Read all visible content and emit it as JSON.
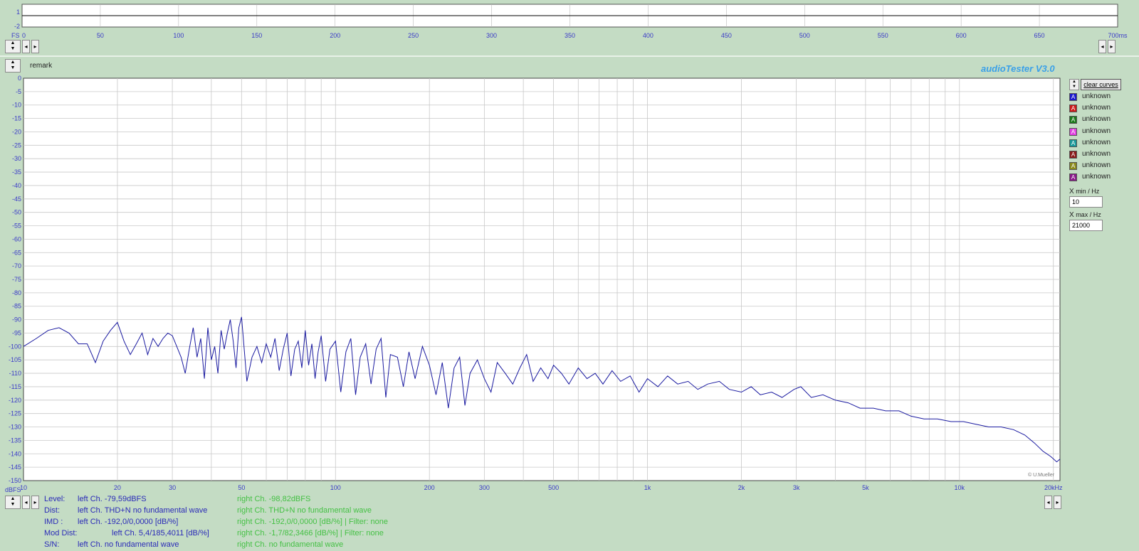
{
  "window": {
    "brand": "audioTester  V3.0",
    "remark_label": "remark",
    "copyright": "© U.Mueller"
  },
  "time_plot": {
    "ylabel": "FS",
    "yticks": [
      "1",
      "-2"
    ],
    "xticks": [
      "0",
      "50",
      "100",
      "150",
      "200",
      "250",
      "300",
      "350",
      "400",
      "450",
      "500",
      "550",
      "600",
      "650",
      "700ms"
    ]
  },
  "controls": {
    "clear_curves": "clear curves",
    "xmin_label": "min / Hz",
    "xmin_value": "10",
    "xmax_label": "max / Hz",
    "xmax_value": "21000"
  },
  "legend": [
    {
      "label": "unknown",
      "color": "#1a1acc"
    },
    {
      "label": "unknown",
      "color": "#cc1a1a"
    },
    {
      "label": "unknown",
      "color": "#1a7a1a"
    },
    {
      "label": "unknown",
      "color": "#e040e0"
    },
    {
      "label": "unknown",
      "color": "#1a9a9a"
    },
    {
      "label": "unknown",
      "color": "#8a1a1a"
    },
    {
      "label": "unknown",
      "color": "#8a8a1a"
    },
    {
      "label": "unknown",
      "color": "#8a1a8a"
    }
  ],
  "status": {
    "level": {
      "label": "Level:",
      "left": "left Ch. -79,59dBFS",
      "right": "right Ch. -98,82dBFS"
    },
    "dist": {
      "label": "Dist:",
      "left": "left Ch. THD+N  no fundamental wave",
      "right": "right Ch. THD+N  no fundamental wave"
    },
    "imd": {
      "label": "IMD  :",
      "left": "left Ch. -192,0/0,0000 [dB/%]",
      "right": "right Ch. -192,0/0,0000 [dB/%] |   Filter: none"
    },
    "moddist": {
      "label": "Mod Dist:",
      "left": "left Ch. 5,4/185,4011 [dB/%]",
      "right": "right Ch. -1,7/82,3466 [dB/%]  |   Filter: none"
    },
    "sn": {
      "label": "S/N:",
      "left": "left Ch.  no fundamental wave",
      "right": "right Ch.  no fundamental wave"
    }
  },
  "chart_data": {
    "type": "line",
    "title": "",
    "xlabel": "",
    "ylabel": "dBFS",
    "x_scale": "log",
    "xlim": [
      10,
      21000
    ],
    "ylim": [
      -150,
      0
    ],
    "grid": true,
    "xtick_labels": [
      "10",
      "20",
      "30",
      "50",
      "100",
      "200",
      "300",
      "500",
      "1k",
      "2k",
      "3k",
      "5k",
      "10k",
      "20kHz"
    ],
    "xtick_values": [
      10,
      20,
      30,
      50,
      100,
      200,
      300,
      500,
      1000,
      2000,
      3000,
      5000,
      10000,
      20000
    ],
    "ytick_values": [
      0,
      -5,
      -10,
      -15,
      -20,
      -25,
      -30,
      -35,
      -40,
      -45,
      -50,
      -55,
      -60,
      -65,
      -70,
      -75,
      -80,
      -85,
      -90,
      -95,
      -100,
      -105,
      -110,
      -115,
      -120,
      -125,
      -130,
      -135,
      -140,
      -145,
      -150
    ],
    "ytick_unit_label": "dBFS",
    "series": [
      {
        "color": "#1a1aa0",
        "points": [
          [
            10,
            -100
          ],
          [
            11,
            -97
          ],
          [
            12,
            -94
          ],
          [
            13,
            -93
          ],
          [
            14,
            -95
          ],
          [
            15,
            -99
          ],
          [
            16,
            -99
          ],
          [
            17,
            -106
          ],
          [
            18,
            -98
          ],
          [
            19,
            -94
          ],
          [
            20,
            -91
          ],
          [
            21,
            -98
          ],
          [
            22,
            -103
          ],
          [
            23,
            -99
          ],
          [
            24,
            -95
          ],
          [
            25,
            -103
          ],
          [
            26,
            -97
          ],
          [
            27,
            -100
          ],
          [
            28,
            -97
          ],
          [
            29,
            -95
          ],
          [
            30,
            -96
          ],
          [
            31,
            -100
          ],
          [
            32,
            -104
          ],
          [
            33,
            -110
          ],
          [
            34,
            -101
          ],
          [
            35,
            -93
          ],
          [
            36,
            -104
          ],
          [
            37,
            -97
          ],
          [
            38,
            -112
          ],
          [
            39,
            -93
          ],
          [
            40,
            -105
          ],
          [
            41,
            -100
          ],
          [
            42,
            -110
          ],
          [
            43,
            -94
          ],
          [
            44,
            -101
          ],
          [
            45,
            -95
          ],
          [
            46,
            -90
          ],
          [
            47,
            -98
          ],
          [
            48,
            -108
          ],
          [
            49,
            -93
          ],
          [
            50,
            -89
          ],
          [
            52,
            -113
          ],
          [
            54,
            -104
          ],
          [
            56,
            -100
          ],
          [
            58,
            -106
          ],
          [
            60,
            -99
          ],
          [
            62,
            -104
          ],
          [
            64,
            -97
          ],
          [
            66,
            -109
          ],
          [
            68,
            -101
          ],
          [
            70,
            -95
          ],
          [
            72,
            -111
          ],
          [
            74,
            -101
          ],
          [
            76,
            -98
          ],
          [
            78,
            -108
          ],
          [
            80,
            -94
          ],
          [
            82,
            -107
          ],
          [
            84,
            -99
          ],
          [
            86,
            -112
          ],
          [
            88,
            -102
          ],
          [
            90,
            -96
          ],
          [
            93,
            -113
          ],
          [
            96,
            -101
          ],
          [
            100,
            -98
          ],
          [
            104,
            -117
          ],
          [
            108,
            -102
          ],
          [
            112,
            -97
          ],
          [
            116,
            -118
          ],
          [
            120,
            -104
          ],
          [
            125,
            -99
          ],
          [
            130,
            -114
          ],
          [
            135,
            -101
          ],
          [
            140,
            -97
          ],
          [
            145,
            -119
          ],
          [
            150,
            -103
          ],
          [
            158,
            -104
          ],
          [
            165,
            -115
          ],
          [
            172,
            -102
          ],
          [
            180,
            -112
          ],
          [
            190,
            -100
          ],
          [
            200,
            -107
          ],
          [
            210,
            -118
          ],
          [
            220,
            -106
          ],
          [
            230,
            -123
          ],
          [
            240,
            -108
          ],
          [
            250,
            -104
          ],
          [
            260,
            -122
          ],
          [
            270,
            -110
          ],
          [
            285,
            -105
          ],
          [
            300,
            -112
          ],
          [
            315,
            -117
          ],
          [
            330,
            -106
          ],
          [
            350,
            -110
          ],
          [
            370,
            -114
          ],
          [
            390,
            -108
          ],
          [
            410,
            -103
          ],
          [
            430,
            -113
          ],
          [
            455,
            -108
          ],
          [
            480,
            -112
          ],
          [
            500,
            -107
          ],
          [
            530,
            -110
          ],
          [
            560,
            -114
          ],
          [
            600,
            -108
          ],
          [
            640,
            -112
          ],
          [
            680,
            -110
          ],
          [
            720,
            -114
          ],
          [
            770,
            -109
          ],
          [
            820,
            -113
          ],
          [
            880,
            -111
          ],
          [
            940,
            -117
          ],
          [
            1000,
            -112
          ],
          [
            1080,
            -115
          ],
          [
            1160,
            -111
          ],
          [
            1250,
            -114
          ],
          [
            1350,
            -113
          ],
          [
            1450,
            -116
          ],
          [
            1560,
            -114
          ],
          [
            1700,
            -113
          ],
          [
            1830,
            -116
          ],
          [
            2000,
            -117
          ],
          [
            2150,
            -115
          ],
          [
            2300,
            -118
          ],
          [
            2500,
            -117
          ],
          [
            2700,
            -119
          ],
          [
            2950,
            -116
          ],
          [
            3100,
            -115
          ],
          [
            3350,
            -119
          ],
          [
            3650,
            -118
          ],
          [
            4000,
            -120
          ],
          [
            4400,
            -121
          ],
          [
            4800,
            -123
          ],
          [
            5300,
            -123
          ],
          [
            5800,
            -124
          ],
          [
            6400,
            -124
          ],
          [
            7000,
            -126
          ],
          [
            7700,
            -127
          ],
          [
            8500,
            -127
          ],
          [
            9400,
            -128
          ],
          [
            10300,
            -128
          ],
          [
            11300,
            -129
          ],
          [
            12400,
            -130
          ],
          [
            13600,
            -130
          ],
          [
            14900,
            -131
          ],
          [
            16200,
            -133
          ],
          [
            17400,
            -136
          ],
          [
            18500,
            -139
          ],
          [
            19600,
            -141
          ],
          [
            20500,
            -143
          ],
          [
            21000,
            -142
          ]
        ]
      }
    ]
  }
}
